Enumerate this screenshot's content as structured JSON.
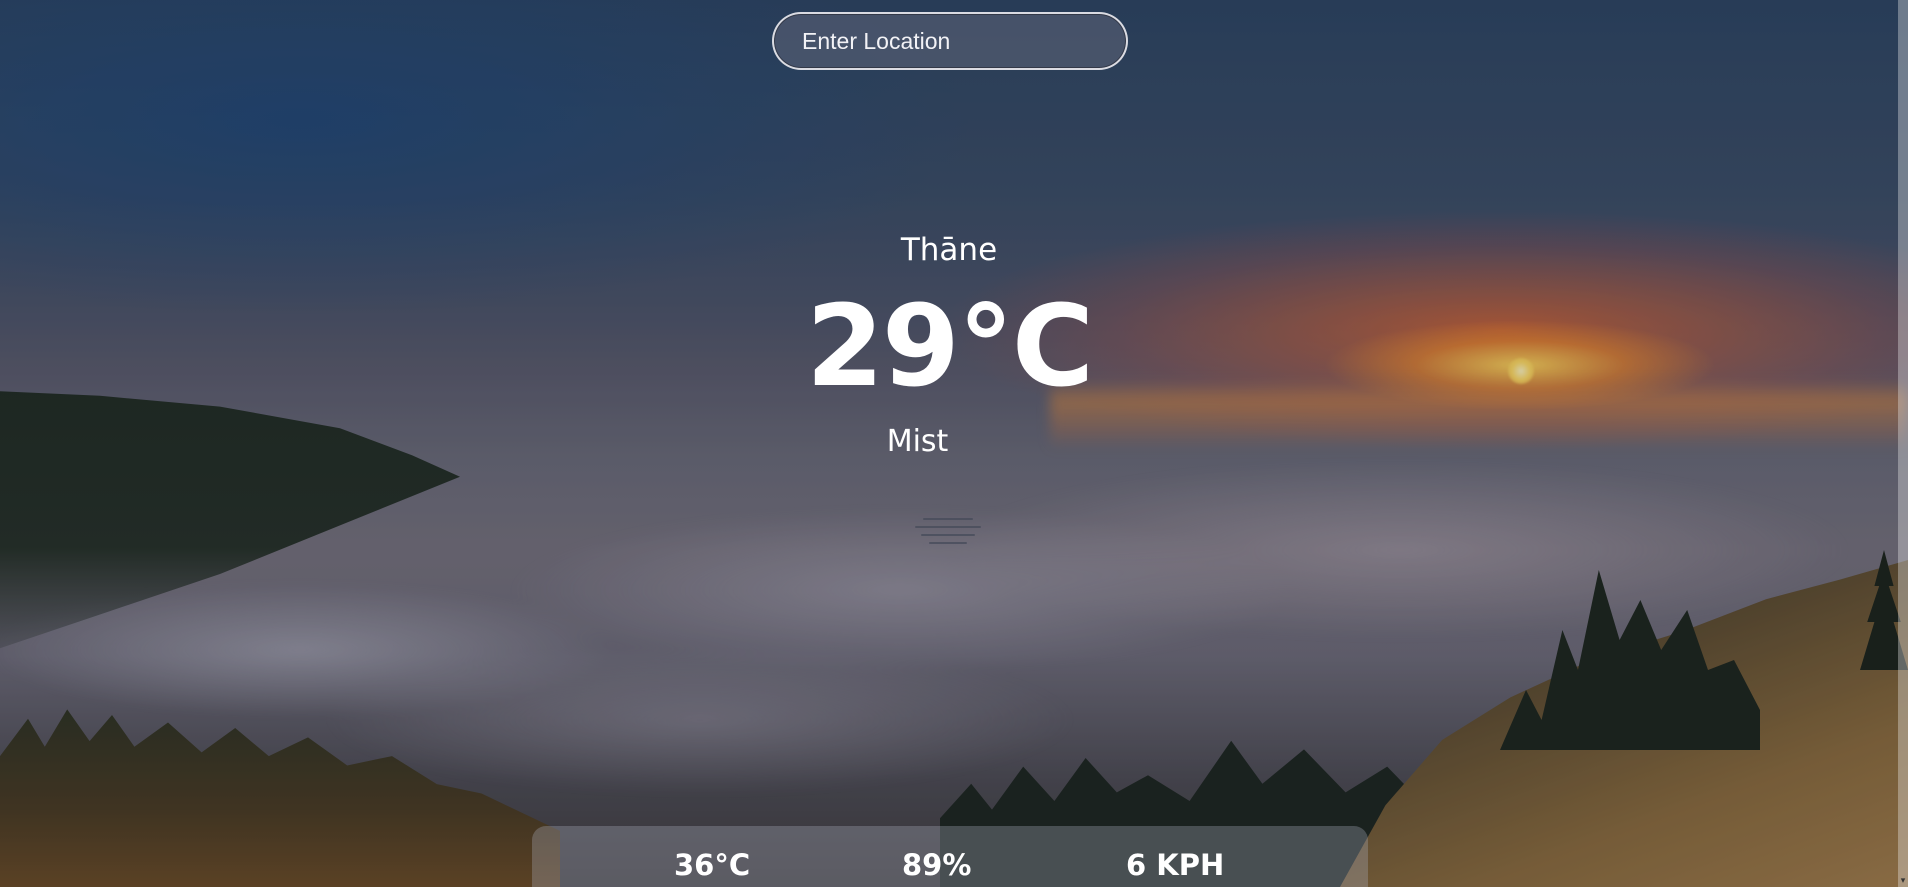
{
  "search": {
    "placeholder": "Enter Location",
    "value": ""
  },
  "weather": {
    "location": "Thāne",
    "temperature": "29°C",
    "condition": "Mist",
    "condition_icon": "mist-icon"
  },
  "stats": {
    "feels_like": "36°C",
    "humidity": "89%",
    "wind": "6 KPH"
  },
  "colors": {
    "text": "#ffffff",
    "panel": "rgba(170,175,190,0.32)",
    "sun": "#ffd960"
  }
}
